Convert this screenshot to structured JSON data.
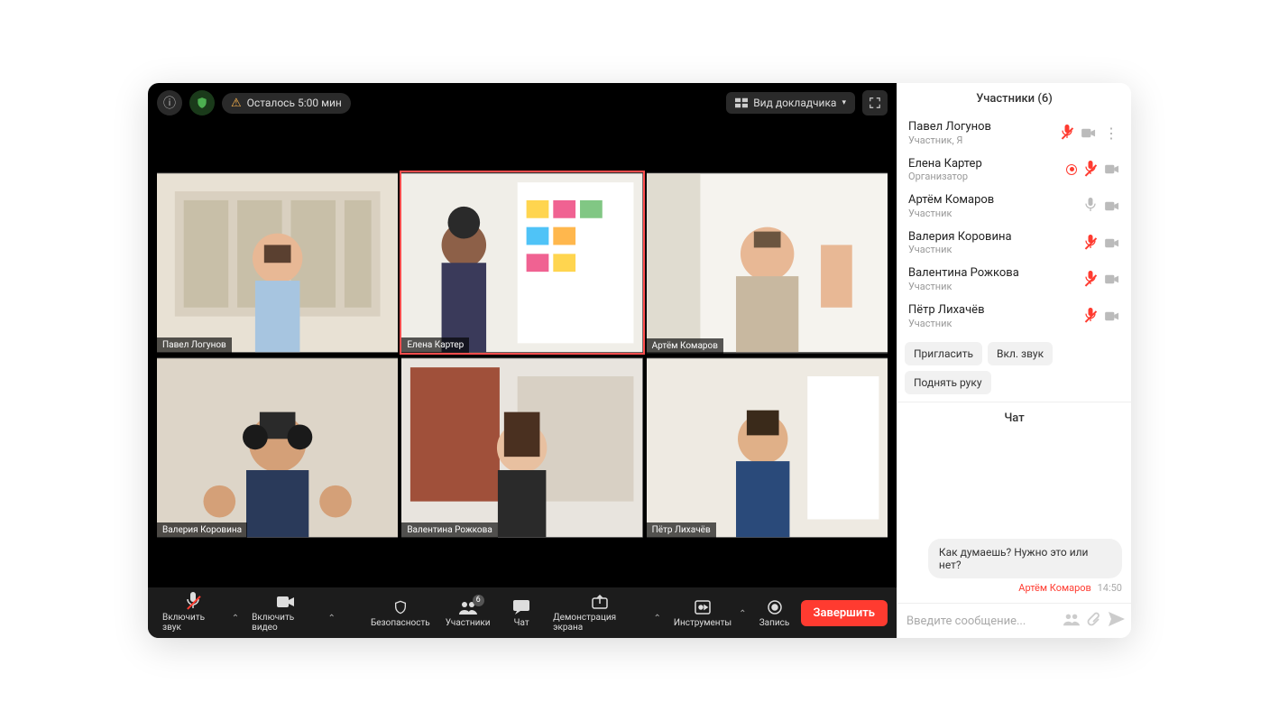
{
  "topBar": {
    "timeRemaining": "Осталось 5:00 мин",
    "viewMode": "Вид докладчика"
  },
  "tiles": [
    {
      "name": "Павел Логунов",
      "active": false
    },
    {
      "name": "Елена Картер",
      "active": true
    },
    {
      "name": "Артём Комаров",
      "active": false
    },
    {
      "name": "Валерия Коровина",
      "active": false
    },
    {
      "name": "Валентина Рожкова",
      "active": false
    },
    {
      "name": "Пётр Лихачёв",
      "active": false
    }
  ],
  "controls": {
    "audio": "Включить звук",
    "video": "Включить видео",
    "security": "Безопасность",
    "participants": "Участники",
    "participantsCount": "6",
    "chat": "Чат",
    "share": "Демонстрация экрана",
    "tools": "Инструменты",
    "record": "Запись",
    "end": "Завершить"
  },
  "participantsPanel": {
    "title": "Участники (6)",
    "list": [
      {
        "name": "Павел Логунов",
        "role": "Участник, Я",
        "micMuted": true,
        "camOn": true,
        "recording": false,
        "more": true
      },
      {
        "name": "Елена Картер",
        "role": "Организатор",
        "micMuted": true,
        "camOn": true,
        "recording": true,
        "more": false
      },
      {
        "name": "Артём Комаров",
        "role": "Участник",
        "micMuted": false,
        "camOn": true,
        "recording": false,
        "more": false
      },
      {
        "name": "Валерия Коровина",
        "role": "Участник",
        "micMuted": true,
        "camOn": true,
        "recording": false,
        "more": false
      },
      {
        "name": "Валентина Рожкова",
        "role": "Участник",
        "micMuted": true,
        "camOn": true,
        "recording": false,
        "more": false
      },
      {
        "name": "Пётр Лихачёв",
        "role": "Участник",
        "micMuted": true,
        "camOn": true,
        "recording": false,
        "more": false
      }
    ],
    "actions": {
      "invite": "Пригласить",
      "muteAll": "Вкл. звук",
      "raiseHand": "Поднять руку"
    }
  },
  "chat": {
    "title": "Чат",
    "message": {
      "text": "Как думаешь? Нужно это или нет?",
      "sender": "Артём Комаров",
      "time": "14:50"
    },
    "placeholder": "Введите сообщение..."
  }
}
